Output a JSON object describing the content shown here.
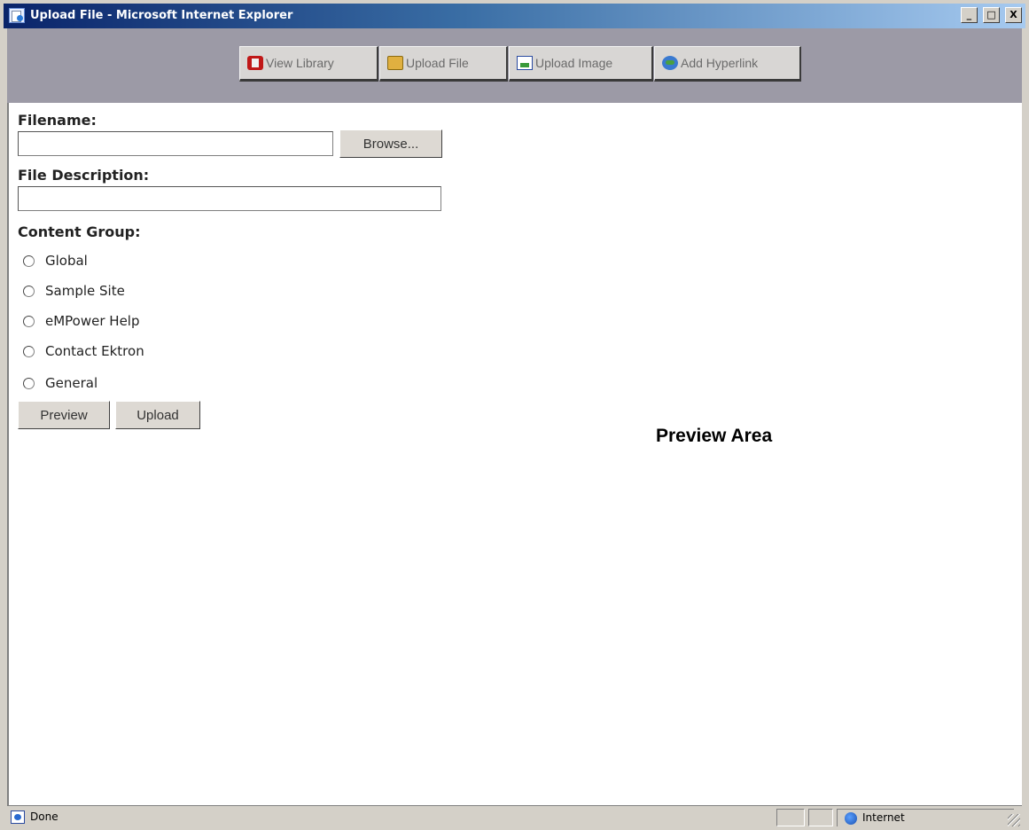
{
  "window": {
    "title": "Upload File - Microsoft Internet Explorer",
    "controls": {
      "minimize": "_",
      "maximize": "□",
      "close": "X"
    }
  },
  "toolbar": {
    "buttons": [
      {
        "label": "View Library",
        "icon": "library-icon"
      },
      {
        "label": "Upload File",
        "icon": "folder-icon"
      },
      {
        "label": "Upload Image",
        "icon": "image-icon"
      },
      {
        "label": "Add Hyperlink",
        "icon": "hyperlink-icon"
      }
    ]
  },
  "form": {
    "filename_label": "Filename:",
    "filename_value": "",
    "browse_label": "Browse...",
    "description_label": "File Description:",
    "description_value": "",
    "content_group_label": "Content Group:",
    "content_groups": [
      "Global",
      "Sample Site",
      "eMPower Help",
      "Contact Ektron",
      "General"
    ],
    "preview_button": "Preview",
    "upload_button": "Upload"
  },
  "preview": {
    "label": "Preview Area"
  },
  "statusbar": {
    "status": "Done",
    "zone": "Internet"
  }
}
